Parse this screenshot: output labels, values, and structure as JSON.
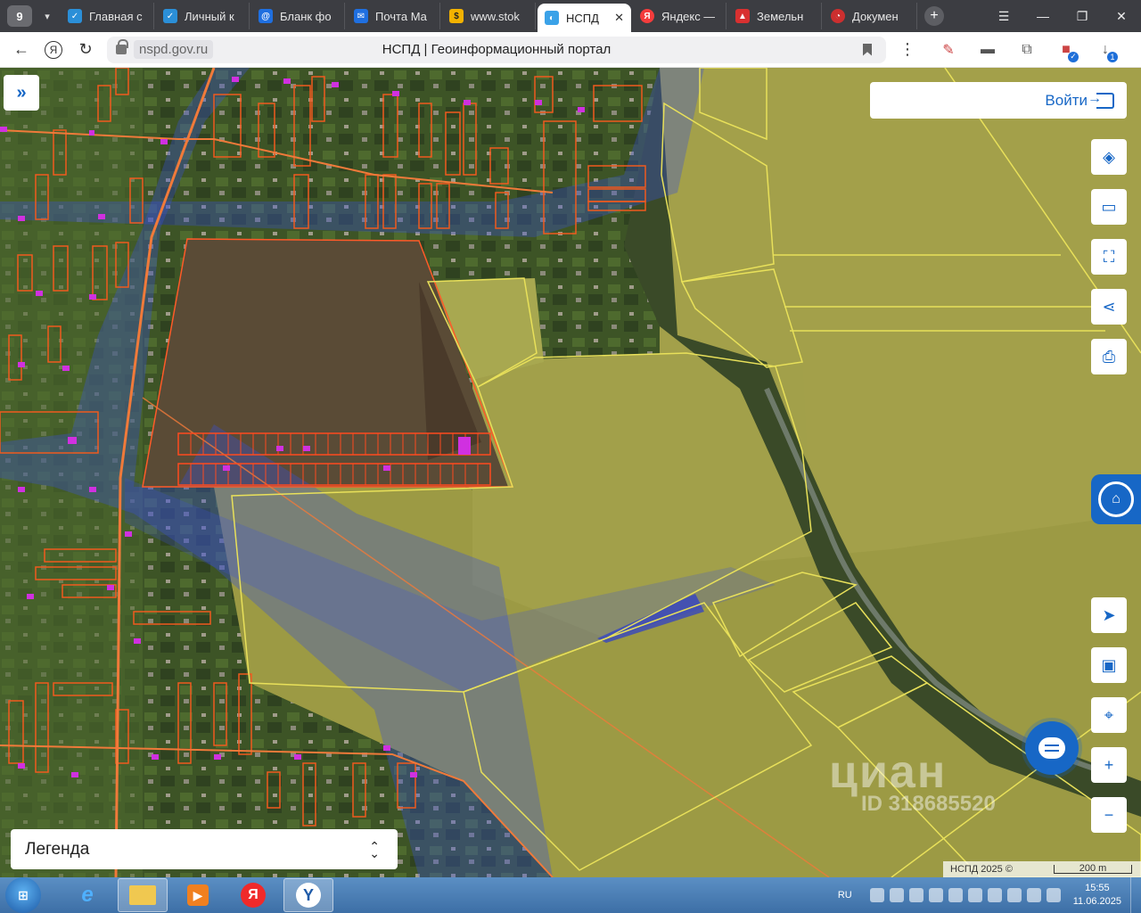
{
  "browser": {
    "tab_count": "9",
    "tabs": [
      {
        "label": "Главная с",
        "icon": "gosuslugi-icon",
        "color": "#2b8fd8"
      },
      {
        "label": "Личный к",
        "icon": "gosuslugi-icon",
        "color": "#2b8fd8"
      },
      {
        "label": "Бланк фо",
        "icon": "mail-at-icon",
        "color": "#1f6fe0"
      },
      {
        "label": "Почта Ма",
        "icon": "mail-envelope-icon",
        "color": "#1f6fe0"
      },
      {
        "label": "www.stok",
        "icon": "stok-icon",
        "color": "#f2b200"
      },
      {
        "label": "НСПД",
        "icon": "nspd-icon",
        "color": "#3ba2e8",
        "active": true
      },
      {
        "label": "Яндекс —",
        "icon": "yandex-icon",
        "color": "#f43c3c"
      },
      {
        "label": "Земельн",
        "icon": "land-icon",
        "color": "#d83030"
      },
      {
        "label": "Докумен",
        "icon": "document-icon",
        "color": "#cc2f2f"
      }
    ],
    "url_domain": "nspd.gov.ru",
    "page_title": "НСПД | Геоинформационный портал"
  },
  "map": {
    "login_label": "Войти",
    "legend_label": "Легенда",
    "watermark_brand": "циан",
    "watermark_id": "ID 318685520",
    "attribution": "НСПД 2025 ©",
    "scale_label": "200 m",
    "tools": [
      "layers-icon",
      "ruler-icon",
      "select-area-icon",
      "share-icon",
      "print-icon"
    ],
    "nav_tools": [
      "locate-arrow-icon",
      "minimap-icon",
      "search-location-icon",
      "zoom-in-icon",
      "zoom-out-icon"
    ],
    "colors": {
      "parcel_outline_orange": "#f05a1e",
      "parcel_outline_yellow": "#e8e05a",
      "zone_blue": "#3a4fd8",
      "field_yellow": "#b9b84a",
      "accent_blue": "#1767c6"
    }
  },
  "taskbar": {
    "language": "RU",
    "time": "15:55",
    "date": "11.06.2025",
    "apps": [
      "explorer-icon",
      "ie-icon",
      "folder-icon",
      "media-player-icon",
      "yandex-browser-icon",
      "yandex-y-icon"
    ]
  }
}
